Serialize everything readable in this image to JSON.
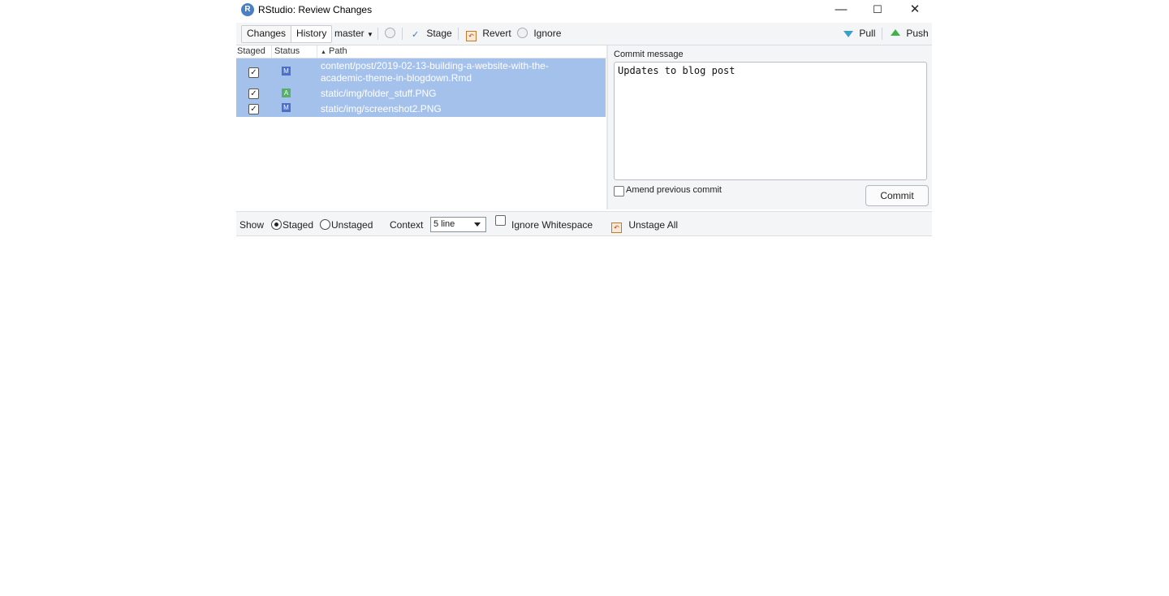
{
  "window": {
    "title": "RStudio: Review Changes",
    "app_icon": "R",
    "controls": {
      "minimize": "—",
      "maximize": "☐",
      "close": "✕"
    }
  },
  "toolbar": {
    "tab_changes": "Changes",
    "tab_history": "History",
    "branch": "master",
    "stage": "Stage",
    "revert": "Revert",
    "ignore": "Ignore",
    "pull": "Pull",
    "push": "Push"
  },
  "file_list": {
    "columns": {
      "staged": "Staged",
      "status": "Status",
      "path": "Path"
    },
    "rows": [
      {
        "staged": true,
        "status": "M",
        "path_line1": "content/post/2019-02-13-building-a-website-with-the-",
        "path_line2": "academic-theme-in-blogdown.Rmd"
      },
      {
        "staged": true,
        "status": "A",
        "path_line1": "static/img/folder_stuff.PNG",
        "path_line2": ""
      },
      {
        "staged": true,
        "status": "M",
        "path_line1": "static/img/screenshot2.PNG",
        "path_line2": ""
      }
    ]
  },
  "commit": {
    "label": "Commit message",
    "message": "Updates to blog post",
    "amend_label": "Amend previous commit",
    "button": "Commit"
  },
  "diff_bar": {
    "show_label": "Show",
    "staged": "Staged",
    "unstaged": "Unstaged",
    "context_label": "Context",
    "context_value": "5 line",
    "ignore_ws": "Ignore Whitespace",
    "unstage_all": "Unstage All"
  },
  "colors": {
    "selection": "#a4c1ec",
    "modified": "#4a6fcf",
    "added": "#56b06a",
    "toolbar": "#f3f5f7"
  }
}
